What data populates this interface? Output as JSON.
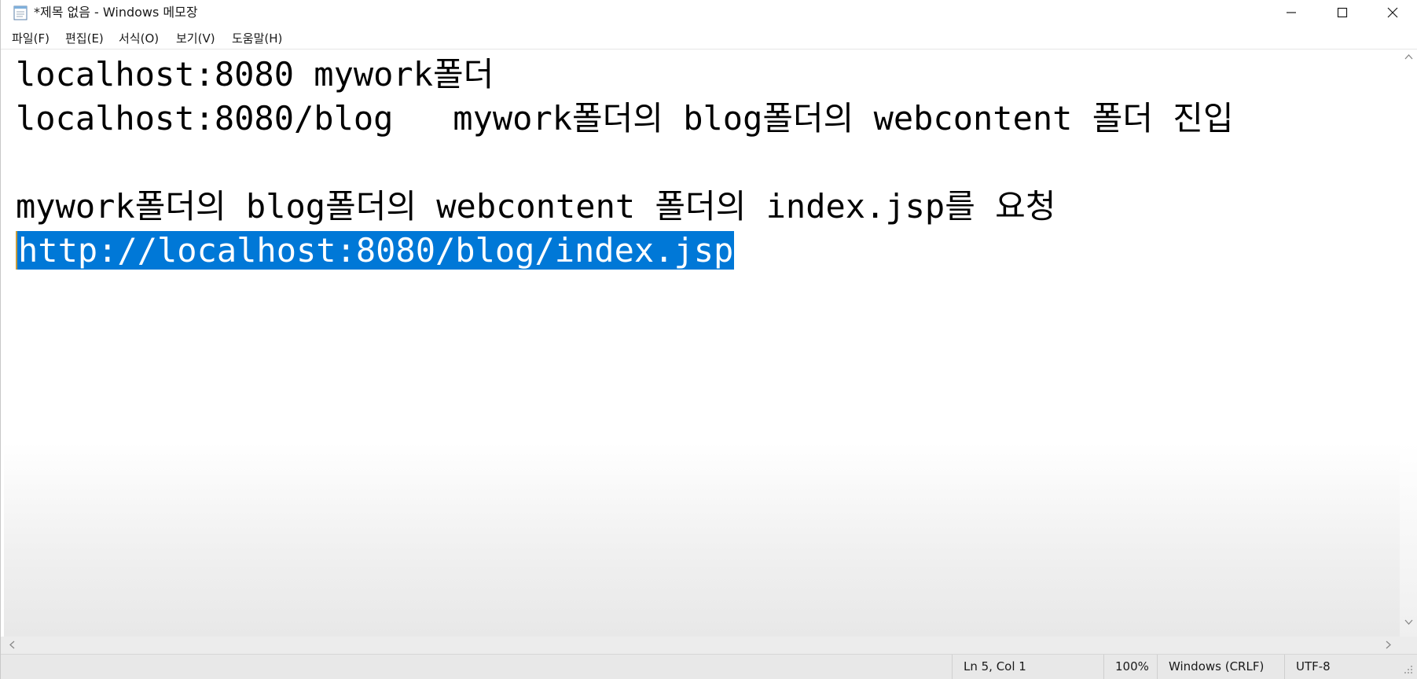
{
  "window": {
    "title": "*제목 없음 - Windows 메모장"
  },
  "menu": {
    "file": "파일(F)",
    "edit": "편집(E)",
    "format": "서식(O)",
    "view": "보기(V)",
    "help": "도움말(H)"
  },
  "editor": {
    "lines": [
      "localhost:8080 mywork폴더",
      "localhost:8080/blog   mywork폴더의 blog폴더의 webcontent 폴더 진입",
      "",
      "mywork폴더의 blog폴더의 webcontent 폴더의 index.jsp를 요청",
      "http://localhost:8080/blog/index.jsp"
    ],
    "selected_line_index": 4
  },
  "status": {
    "position": "Ln 5, Col 1",
    "zoom": "100%",
    "line_ending": "Windows (CRLF)",
    "encoding": "UTF-8"
  },
  "colors": {
    "selection": "#0078d7",
    "status_bar": "#e8e8e8"
  },
  "icons": {
    "app": "notepad-icon",
    "minimize": "minimize-icon",
    "maximize": "maximize-icon",
    "close": "close-icon"
  }
}
